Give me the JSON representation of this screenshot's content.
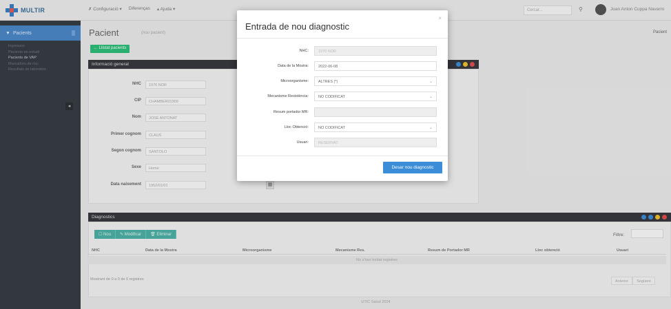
{
  "app": {
    "logo_text": "MULTIR"
  },
  "topnav": {
    "items": [
      "✗ Configuració ▾",
      "Diferenças",
      "▴ Ajuda ▾"
    ]
  },
  "header": {
    "search_placeholder": "Cercar...",
    "user_name": "Joan Anton Cuppa Navarro"
  },
  "sidebar": {
    "active_label": "Pacients",
    "items": [
      "Ingressos",
      "Pacients en estudi",
      "Pacients de VAP",
      "Marcadors de risc",
      "Resultats de laboratori"
    ],
    "selected_index": 2,
    "toggle_glyph": "◂"
  },
  "page": {
    "title": "Pacient",
    "subtitle": "(nou pacient)",
    "breadcrumb": "Pacient",
    "back_button": "← Llistat pacients"
  },
  "general_panel": {
    "title": "Informació general",
    "fields": [
      {
        "label": "NHC",
        "value": "1970 NOR"
      },
      {
        "label": "CIP",
        "value": "CHAMBER01909"
      },
      {
        "label": "Nom",
        "value": "JOSE ANTONAT"
      },
      {
        "label": "Primer cognom",
        "value": "CLAUS"
      },
      {
        "label": "Segon cognom",
        "value": "SANTOLO"
      },
      {
        "label": "Sexe",
        "value": "Home"
      },
      {
        "label": "Data naixement",
        "value": "1952/01/01"
      }
    ],
    "calendar_glyph": "▦"
  },
  "diagnostics_panel": {
    "title": "Diagnostics",
    "buttons": [
      "☐ Nou",
      "✎ Modificar",
      "🗑 Eliminar"
    ],
    "filter_label": "Filtre:",
    "columns": [
      "NHC",
      "Data de la Mostra",
      "Microorganisme",
      "Mecanisme Res.",
      "Resum de Portador MR",
      "Lloc obtenció",
      "Usuari"
    ],
    "empty_message": "No s'han trobat registres",
    "info": "Mostrant de 0 a 0 de 0 registres",
    "pager": [
      "Anterior",
      "Següent"
    ]
  },
  "footer": {
    "text": "UTIC Salud 2024"
  },
  "modal": {
    "title": "Entrada de nou diagnostic",
    "close_glyph": "×",
    "fields": [
      {
        "label": "NHC:",
        "value": "1970 NOR",
        "readonly": true,
        "select": false
      },
      {
        "label": "Data de la Mostra:",
        "value": "2022-06-08",
        "readonly": false,
        "select": false
      },
      {
        "label": "Microorganisme:",
        "value": "ALTRES (*)",
        "readonly": false,
        "select": true
      },
      {
        "label": "Mecanisme Resistència:",
        "value": "NO CODIFICAT",
        "readonly": false,
        "select": true
      },
      {
        "label": "Resum portador MR:",
        "value": "",
        "readonly": true,
        "select": false
      },
      {
        "label": "Lloc Obtenció:",
        "value": "NO CODIFICAT",
        "readonly": false,
        "select": true
      },
      {
        "label": "Usuari:",
        "value": "RESERVAT",
        "readonly": true,
        "select": false
      }
    ],
    "submit_label": "Desar nou diagnostic"
  },
  "colors": {
    "accent": "#3c8dd8",
    "sidebar_bg": "#383d44",
    "sidebar_active": "#4b88c9",
    "panel_header": "#37393e",
    "green_button": "#2dbf7a",
    "teal_button": "#4cb1a6",
    "dot_colors": [
      "#3c8dd8",
      "#f0c12e",
      "#e34d4d"
    ]
  }
}
